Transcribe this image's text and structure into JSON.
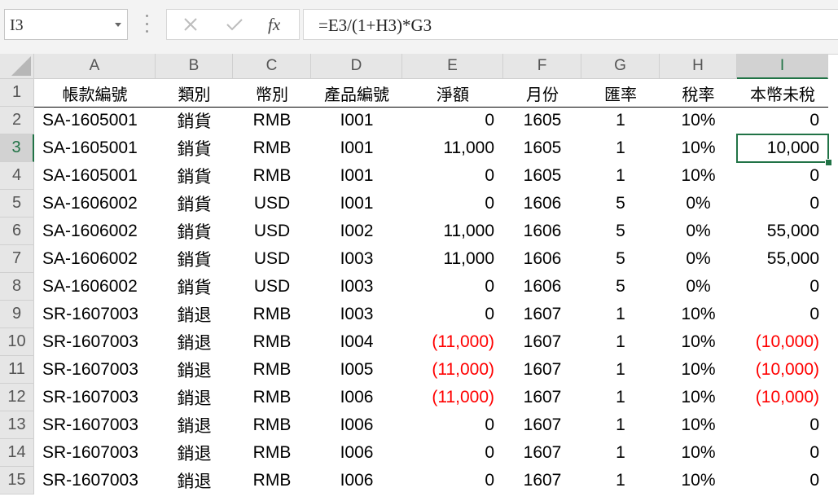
{
  "name_box": {
    "value": "I3"
  },
  "formula_bar": {
    "fx_label": "fx",
    "formula": "=E3/(1+H3)*G3"
  },
  "columns": [
    "A",
    "B",
    "C",
    "D",
    "E",
    "F",
    "G",
    "H",
    "I"
  ],
  "selected_cell": {
    "column": "I",
    "row": "3"
  },
  "rows": [
    {
      "n": "1",
      "cells": [
        "帳款編號",
        "類別",
        "幣別",
        "產品編號",
        "淨額",
        "月份",
        "匯率",
        "稅率",
        "本幣未稅"
      ]
    },
    {
      "n": "2",
      "cells": [
        "SA-1605001",
        "銷貨",
        "RMB",
        "I001",
        "0",
        "1605",
        "1",
        "10%",
        "0"
      ]
    },
    {
      "n": "3",
      "cells": [
        "SA-1605001",
        "銷貨",
        "RMB",
        "I001",
        "11,000",
        "1605",
        "1",
        "10%",
        "10,000"
      ]
    },
    {
      "n": "4",
      "cells": [
        "SA-1605001",
        "銷貨",
        "RMB",
        "I001",
        "0",
        "1605",
        "1",
        "10%",
        "0"
      ]
    },
    {
      "n": "5",
      "cells": [
        "SA-1606002",
        "銷貨",
        "USD",
        "I001",
        "0",
        "1606",
        "5",
        "0%",
        "0"
      ]
    },
    {
      "n": "6",
      "cells": [
        "SA-1606002",
        "銷貨",
        "USD",
        "I002",
        "11,000",
        "1606",
        "5",
        "0%",
        "55,000"
      ]
    },
    {
      "n": "7",
      "cells": [
        "SA-1606002",
        "銷貨",
        "USD",
        "I003",
        "11,000",
        "1606",
        "5",
        "0%",
        "55,000"
      ]
    },
    {
      "n": "8",
      "cells": [
        "SA-1606002",
        "銷貨",
        "USD",
        "I003",
        "0",
        "1606",
        "5",
        "0%",
        "0"
      ]
    },
    {
      "n": "9",
      "cells": [
        "SR-1607003",
        "銷退",
        "RMB",
        "I003",
        "0",
        "1607",
        "1",
        "10%",
        "0"
      ]
    },
    {
      "n": "10",
      "cells": [
        "SR-1607003",
        "銷退",
        "RMB",
        "I004",
        "(11,000)",
        "1607",
        "1",
        "10%",
        "(10,000)"
      ]
    },
    {
      "n": "11",
      "cells": [
        "SR-1607003",
        "銷退",
        "RMB",
        "I005",
        "(11,000)",
        "1607",
        "1",
        "10%",
        "(10,000)"
      ]
    },
    {
      "n": "12",
      "cells": [
        "SR-1607003",
        "銷退",
        "RMB",
        "I006",
        "(11,000)",
        "1607",
        "1",
        "10%",
        "(10,000)"
      ]
    },
    {
      "n": "13",
      "cells": [
        "SR-1607003",
        "銷退",
        "RMB",
        "I006",
        "0",
        "1607",
        "1",
        "10%",
        "0"
      ]
    },
    {
      "n": "14",
      "cells": [
        "SR-1607003",
        "銷退",
        "RMB",
        "I006",
        "0",
        "1607",
        "1",
        "10%",
        "0"
      ]
    },
    {
      "n": "15",
      "cells": [
        "SR-1607003",
        "銷退",
        "RMB",
        "I006",
        "0",
        "1607",
        "1",
        "10%",
        "0"
      ]
    }
  ],
  "colors": {
    "accent": "#217346",
    "negative": "#ff0000",
    "header_bg": "#e6e6e6"
  },
  "icons": {
    "cancel": "x-icon",
    "enter": "checkmark-icon",
    "name_box_dropdown": "chevron-down-icon"
  }
}
